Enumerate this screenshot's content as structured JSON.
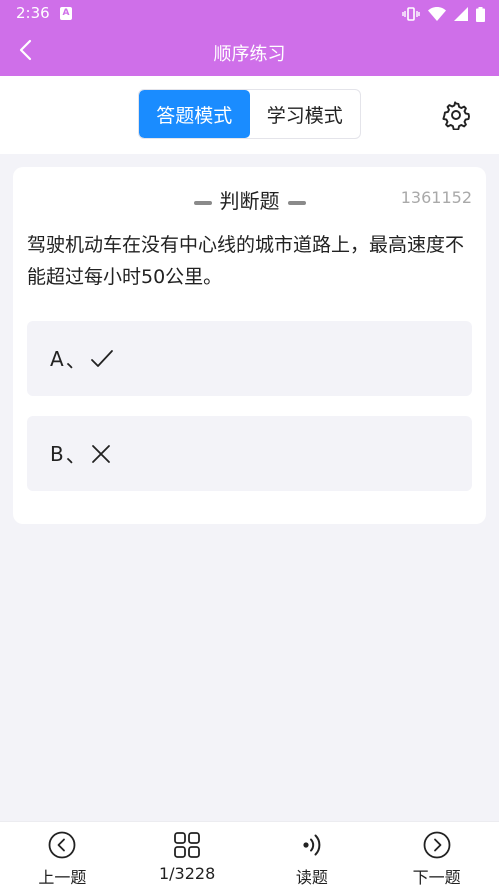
{
  "status_bar": {
    "time": "2:36",
    "notification_letter": "A"
  },
  "header": {
    "title": "顺序练习"
  },
  "mode_tabs": [
    {
      "label": "答题模式",
      "active": true
    },
    {
      "label": "学习模式",
      "active": false
    }
  ],
  "question": {
    "type": "判断题",
    "id": "1361152",
    "text": "驾驶机动车在没有中心线的城市道路上，最高速度不能超过每小时50公里。",
    "options": [
      {
        "letter": "A",
        "separator": "、",
        "icon": "check-icon"
      },
      {
        "letter": "B",
        "separator": "、",
        "icon": "cross-icon"
      }
    ]
  },
  "bottom_nav": {
    "prev": "上一题",
    "progress": "1/3228",
    "read": "读题",
    "next": "下一题"
  },
  "colors": {
    "header": "#cf6fe9",
    "accent": "#1a8cff",
    "background": "#f3f3f8"
  }
}
